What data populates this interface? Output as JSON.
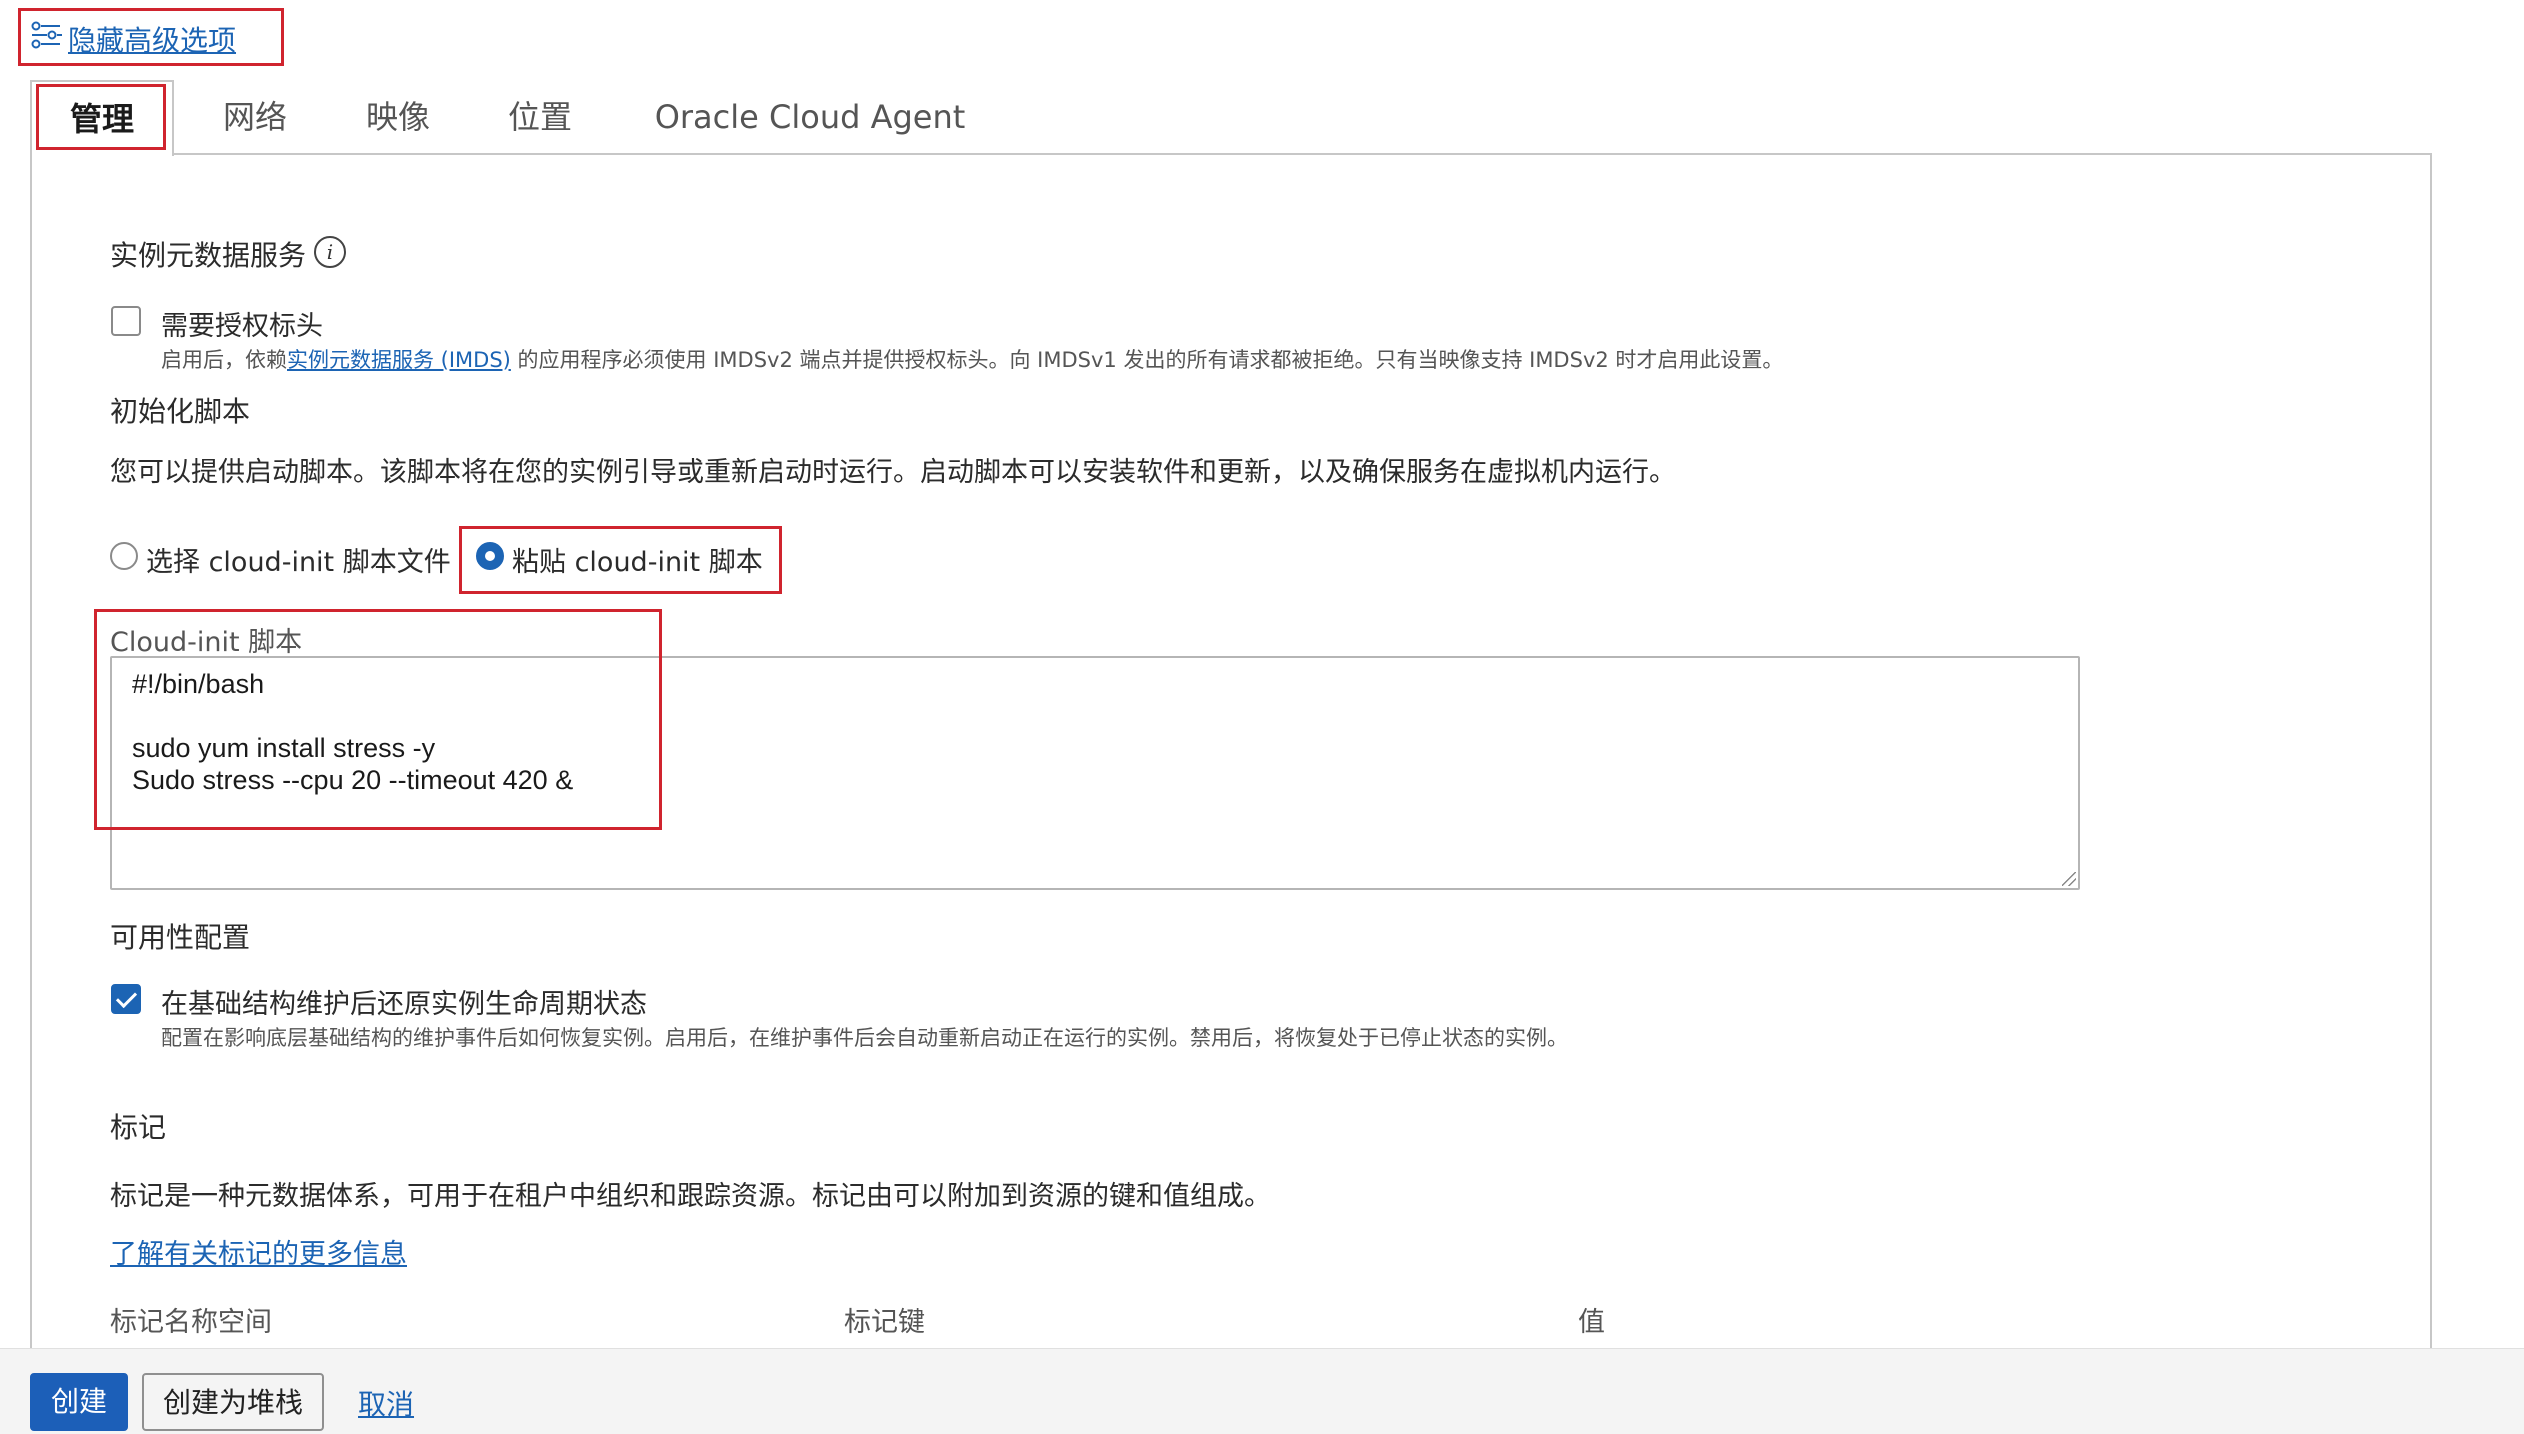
{
  "advanced": {
    "link_label": "隐藏高级选项",
    "icon": "sliders-icon"
  },
  "tabs": [
    {
      "label": "管理",
      "active": true
    },
    {
      "label": "网络",
      "active": false
    },
    {
      "label": "映像",
      "active": false
    },
    {
      "label": "位置",
      "active": false
    },
    {
      "label": "Oracle Cloud Agent",
      "active": false
    }
  ],
  "imds": {
    "title": "实例元数据服务",
    "info_icon": "i",
    "checkbox_label": "需要授权标头",
    "checked": false,
    "help_prefix": "启用后，依赖",
    "help_link": "实例元数据服务 (IMDS)",
    "help_suffix": " 的应用程序必须使用 IMDSv2 端点并提供授权标头。向 IMDSv1 发出的所有请求都被拒绝。只有当映像支持 IMDSv2 时才启用此设置。"
  },
  "init_script": {
    "title": "初始化脚本",
    "description": "您可以提供启动脚本。该脚本将在您的实例引导或重新启动时运行。启动脚本可以安装软件和更新，以及确保服务在虚拟机内运行。",
    "radio_file_label": "选择 cloud-init 脚本文件",
    "radio_paste_label": "粘贴 cloud-init 脚本",
    "selected": "paste",
    "field_label": "Cloud-init 脚本",
    "script": "#!/bin/bash\n\nsudo yum install stress -y\nSudo stress --cpu 20 --timeout 420 &"
  },
  "availability": {
    "title": "可用性配置",
    "checkbox_label": "在基础结构维护后还原实例生命周期状态",
    "checked": true,
    "help": "配置在影响底层基础结构的维护事件后如何恢复实例。启用后，在维护事件后会自动重新启动正在运行的实例。禁用后，将恢复处于已停止状态的实例。"
  },
  "tags": {
    "title": "标记",
    "description": "标记是一种元数据体系，可用于在租户中组织和跟踪资源。标记由可以附加到资源的键和值组成。",
    "learn_more": "了解有关标记的更多信息",
    "columns": [
      "标记名称空间",
      "标记键",
      "值"
    ]
  },
  "footer": {
    "create": "创建",
    "create_stack": "创建为堆栈",
    "cancel": "取消"
  },
  "colors": {
    "accent": "#1c64b4",
    "primary_button": "#1c5fb8",
    "annotation": "#d0242e"
  }
}
